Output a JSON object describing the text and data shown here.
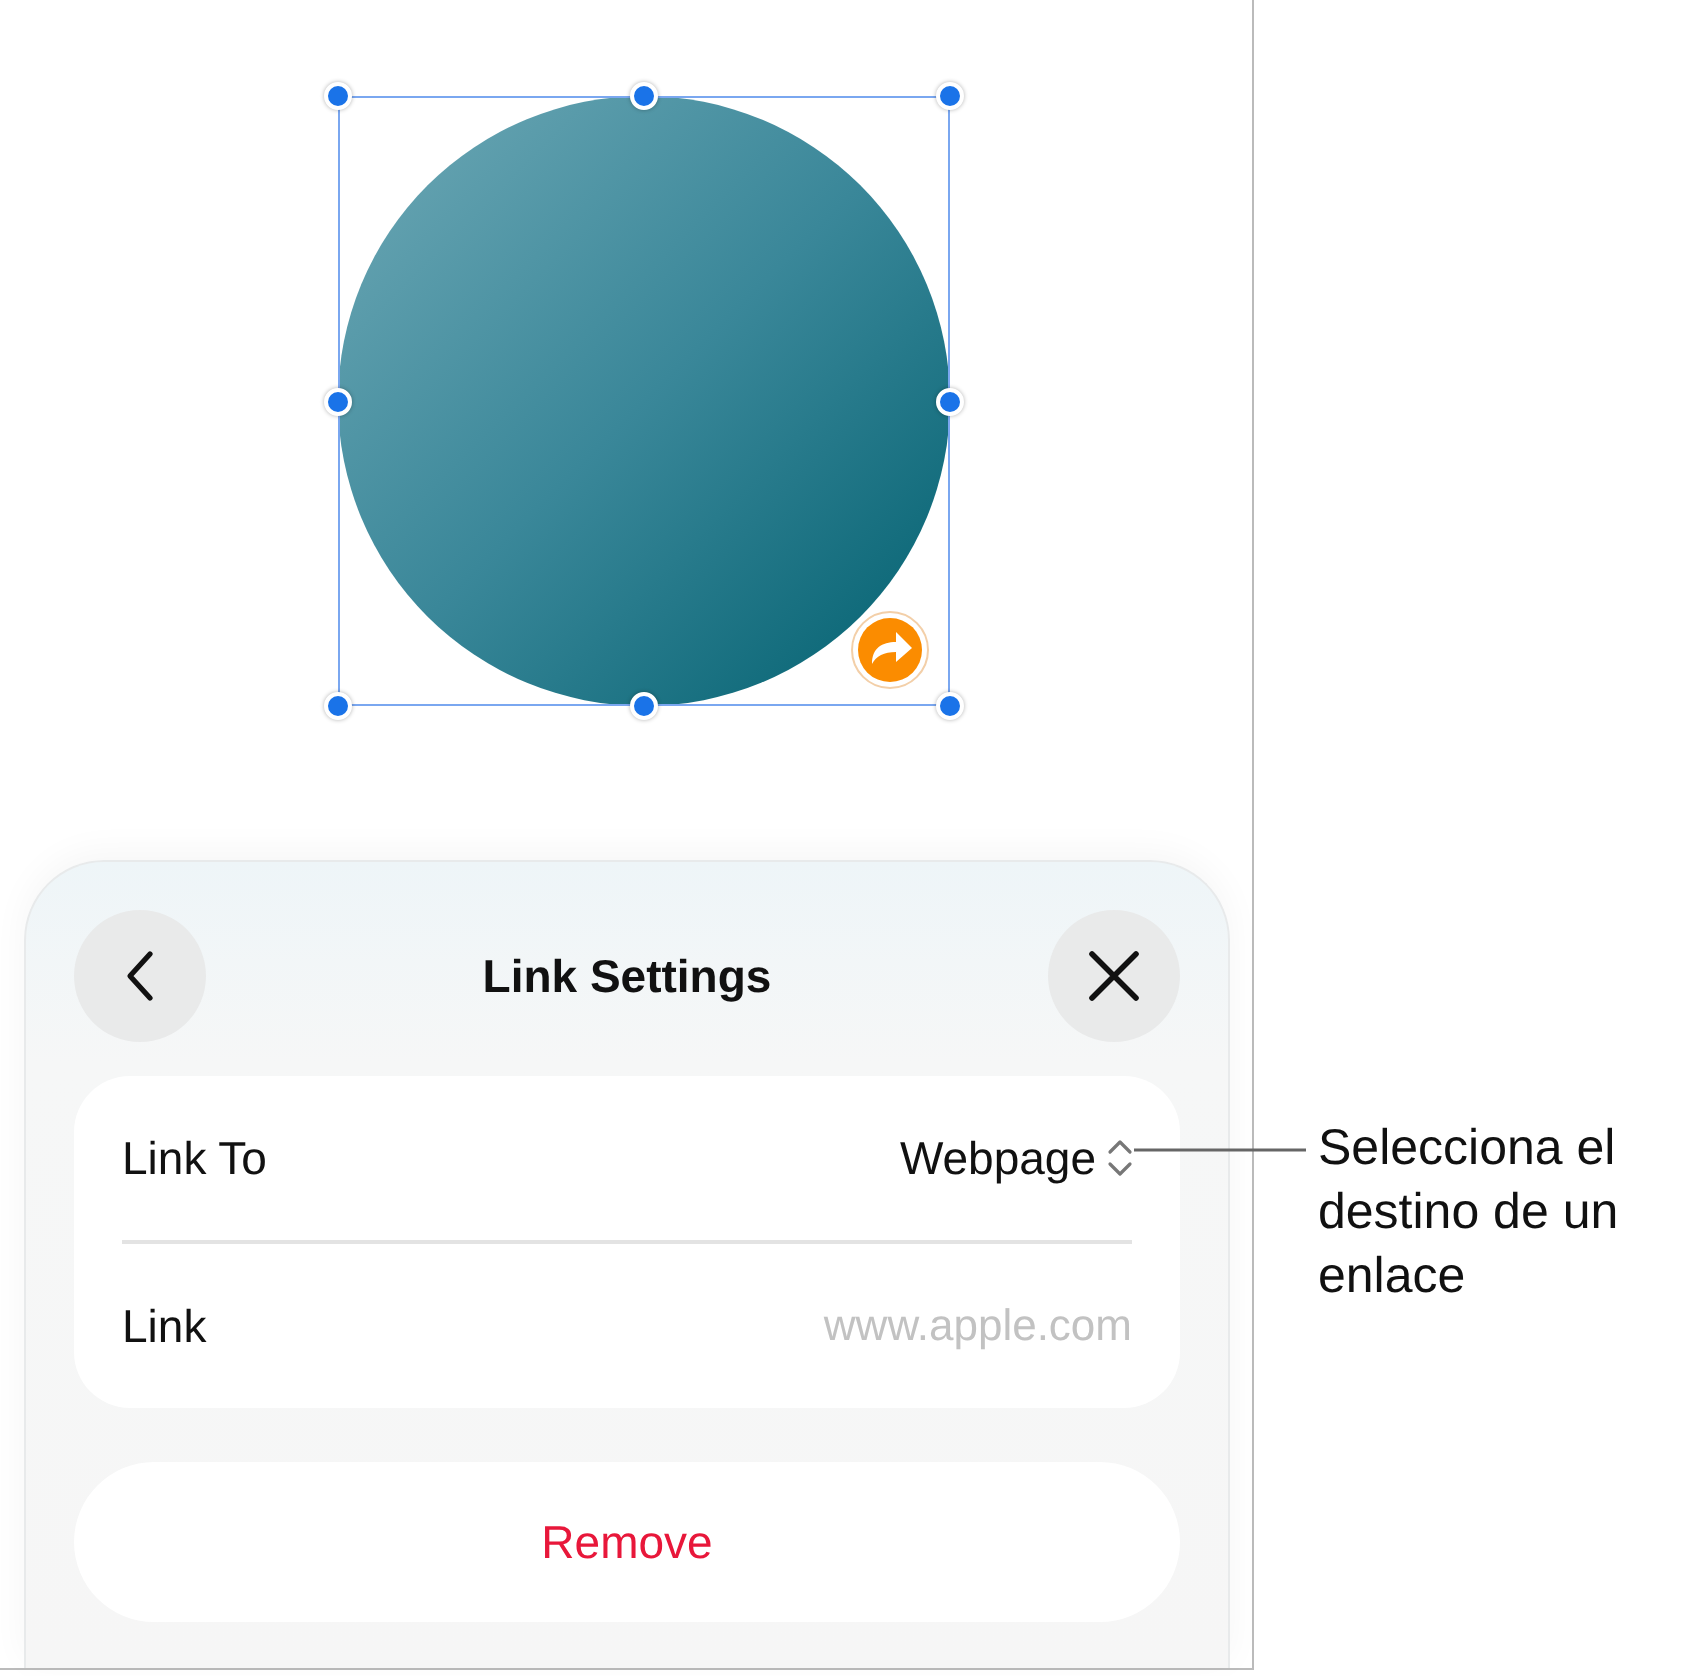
{
  "canvas": {
    "shape": {
      "selected": true,
      "has_link": true
    }
  },
  "link_settings": {
    "title": "Link Settings",
    "rows": [
      {
        "kind": "popup",
        "label": "Link To",
        "value": "Webpage"
      },
      {
        "kind": "field",
        "label": "Link",
        "placeholder": "www.apple.com"
      }
    ],
    "remove_button": "Remove"
  },
  "callout": {
    "text": "Selecciona el destino de un enlace"
  }
}
